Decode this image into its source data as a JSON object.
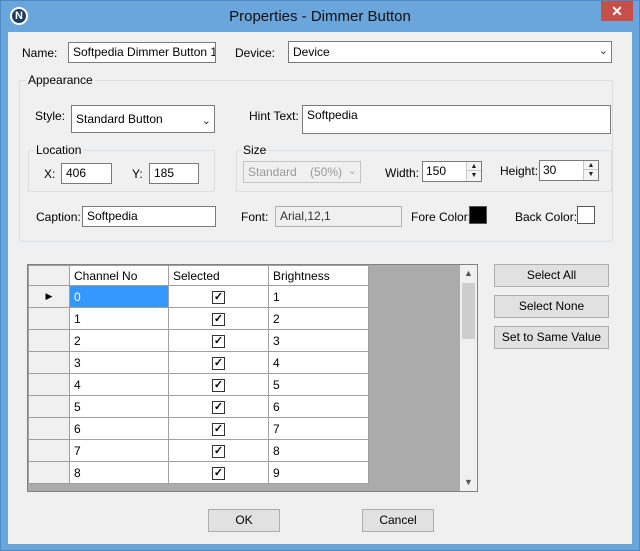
{
  "window": {
    "title": "Properties - Dimmer Button",
    "app_icon_letter": "N",
    "close_glyph": "✕"
  },
  "form": {
    "name_label": "Name:",
    "name_value": "Softpedia Dimmer Button 1",
    "device_label": "Device:",
    "device_value": "Device",
    "appearance_title": "Appearance",
    "style_label": "Style:",
    "style_value": "Standard Button",
    "hint_label": "Hint Text:",
    "hint_value": "Softpedia",
    "location_title": "Location",
    "x_label": "X:",
    "x_value": "406",
    "y_label": "Y:",
    "y_value": "185",
    "size_title": "Size",
    "size_value": "Standard    (50%)",
    "width_label": "Width:",
    "width_value": "150",
    "height_label": "Height:",
    "height_value": "30",
    "caption_label": "Caption:",
    "caption_value": "Softpedia",
    "font_label": "Font:",
    "font_value": "Arial,12,1",
    "fore_color_label": "Fore Color:",
    "fore_color": "#000000",
    "back_color_label": "Back Color:",
    "back_color": "#ffffff"
  },
  "grid": {
    "columns": [
      "Channel No",
      "Selected",
      "Brightness"
    ],
    "rows": [
      {
        "channel": "0",
        "selected": true,
        "brightness": "1"
      },
      {
        "channel": "1",
        "selected": true,
        "brightness": "2"
      },
      {
        "channel": "2",
        "selected": true,
        "brightness": "3"
      },
      {
        "channel": "3",
        "selected": true,
        "brightness": "4"
      },
      {
        "channel": "4",
        "selected": true,
        "brightness": "5"
      },
      {
        "channel": "5",
        "selected": true,
        "brightness": "6"
      },
      {
        "channel": "6",
        "selected": true,
        "brightness": "7"
      },
      {
        "channel": "7",
        "selected": true,
        "brightness": "8"
      },
      {
        "channel": "8",
        "selected": true,
        "brightness": "9"
      }
    ],
    "current_row_marker": "▶",
    "check_glyph": "✓"
  },
  "side_buttons": {
    "select_all": "Select All",
    "select_none": "Select None",
    "set_same": "Set to Same Value"
  },
  "footer": {
    "ok": "OK",
    "cancel": "Cancel"
  },
  "icons": {
    "dropdown": "⌄",
    "spin_up": "▲",
    "spin_down": "▼",
    "scroll_up": "▲",
    "scroll_down": "▼"
  }
}
